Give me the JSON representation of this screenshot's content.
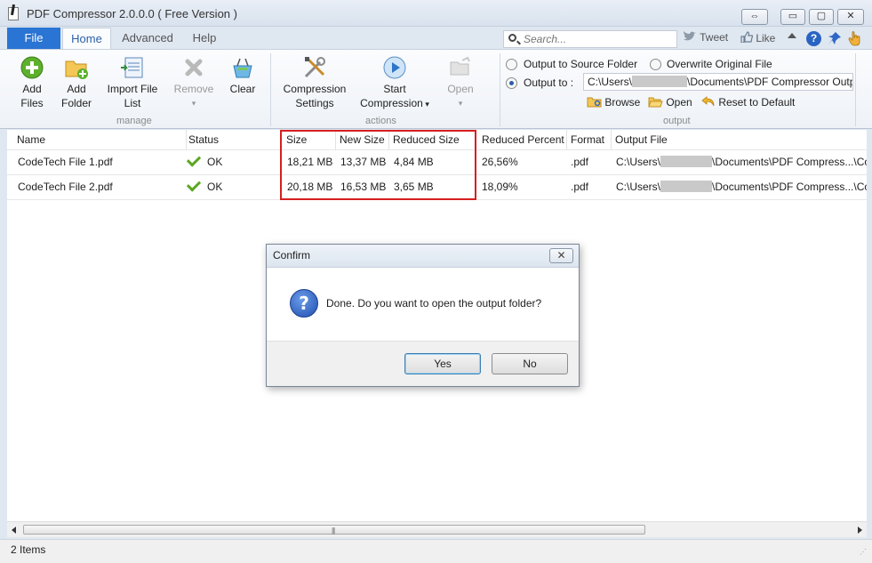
{
  "window": {
    "title": "PDF Compressor 2.0.0.0 ( Free Version )",
    "controls": {
      "extra": "⇔",
      "minimize": "▭",
      "maximize": "▢",
      "close": "✕"
    }
  },
  "ribbon_tabs": {
    "file": "File",
    "home": "Home",
    "advanced": "Advanced",
    "help": "Help"
  },
  "search": {
    "placeholder": "Search..."
  },
  "social": {
    "tweet": "Tweet",
    "like": "Like"
  },
  "ribbon": {
    "manage": {
      "add_files": [
        "Add",
        "Files"
      ],
      "add_folder": [
        "Add",
        "Folder"
      ],
      "import_file_list": [
        "Import File",
        "List"
      ],
      "remove": "Remove",
      "clear": "Clear",
      "label": "manage"
    },
    "actions": {
      "compression_settings": [
        "Compression",
        "Settings"
      ],
      "start_compression": [
        "Start",
        "Compression"
      ],
      "open": "Open",
      "label": "actions"
    },
    "output": {
      "output_to_source": "Output to Source Folder",
      "overwrite_original": "Overwrite Original File",
      "output_to": "Output to :",
      "path_prefix": "C:\\Users\\",
      "path_suffix": "\\Documents\\PDF Compressor Output",
      "browse": "Browse",
      "open": "Open",
      "reset": "Reset to Default",
      "label": "output",
      "selected": "output_to"
    }
  },
  "table": {
    "columns": [
      "Name",
      "Status",
      "Size",
      "New Size",
      "Reduced Size",
      "Reduced Percent",
      "Format",
      "Output File"
    ],
    "rows": [
      {
        "name": "CodeTech File 1.pdf",
        "status": "OK",
        "size": "18,21 MB",
        "new_size": "13,37 MB",
        "reduced_size": "4,84 MB",
        "reduced_percent": "26,56%",
        "format": ".pdf",
        "output_prefix": "C:\\Users\\",
        "output_suffix": "\\Documents\\PDF Compress...\\CodeTech"
      },
      {
        "name": "CodeTech File 2.pdf",
        "status": "OK",
        "size": "20,18 MB",
        "new_size": "16,53 MB",
        "reduced_size": "3,65 MB",
        "reduced_percent": "18,09%",
        "format": ".pdf",
        "output_prefix": "C:\\Users\\",
        "output_suffix": "\\Documents\\PDF Compress...\\CodeTech"
      }
    ]
  },
  "status_bar": {
    "items": "2 Items"
  },
  "dialog": {
    "title": "Confirm",
    "close": "✕",
    "message": "Done. Do you want to open the output folder?",
    "yes": "Yes",
    "no": "No"
  },
  "colors": {
    "accent": "#2a74d4",
    "highlight_border": "#d51f1f",
    "ok_green": "#5aa823"
  }
}
